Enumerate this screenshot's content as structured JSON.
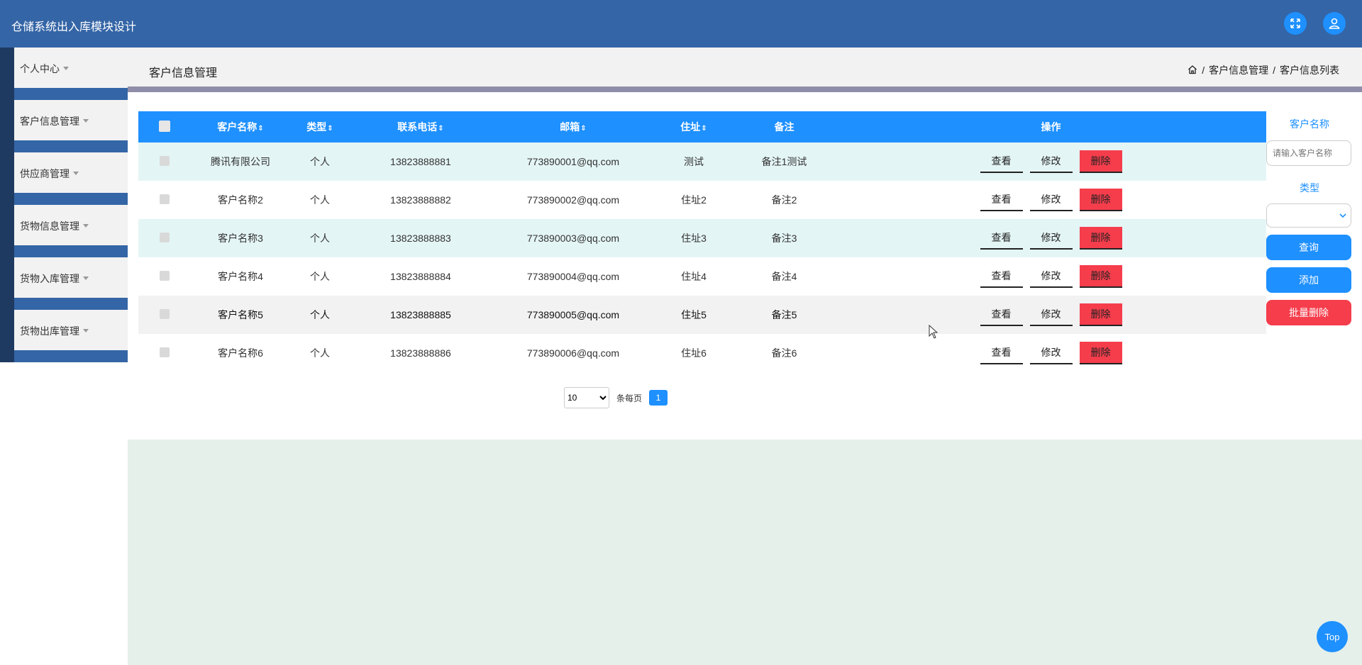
{
  "app": {
    "title": "仓储系统出入库模块设计"
  },
  "header_icons": [
    "fullscreen-icon",
    "user-icon"
  ],
  "sidebar": {
    "items": [
      {
        "label": "个人中心"
      },
      {
        "label": "客户信息管理"
      },
      {
        "label": "供应商管理"
      },
      {
        "label": "货物信息管理"
      },
      {
        "label": "货物入库管理"
      },
      {
        "label": "货物出库管理"
      }
    ]
  },
  "page": {
    "title": "客户信息管理",
    "breadcrumb": {
      "level1": "客户信息管理",
      "level2": "客户信息列表",
      "sep": "/"
    }
  },
  "table": {
    "headers": {
      "name": "客户名称",
      "type": "类型",
      "phone": "联系电话",
      "email": "邮箱",
      "address": "住址",
      "remark": "备注",
      "actions": "操作"
    },
    "sort_glyph": "⇕",
    "rows": [
      {
        "name": "腾讯有限公司",
        "type": "个人",
        "phone": "13823888881",
        "email": "773890001@qq.com",
        "address": "测试",
        "remark": "备注1测试"
      },
      {
        "name": "客户名称2",
        "type": "个人",
        "phone": "13823888882",
        "email": "773890002@qq.com",
        "address": "住址2",
        "remark": "备注2"
      },
      {
        "name": "客户名称3",
        "type": "个人",
        "phone": "13823888883",
        "email": "773890003@qq.com",
        "address": "住址3",
        "remark": "备注3"
      },
      {
        "name": "客户名称4",
        "type": "个人",
        "phone": "13823888884",
        "email": "773890004@qq.com",
        "address": "住址4",
        "remark": "备注4"
      },
      {
        "name": "客户名称5",
        "type": "个人",
        "phone": "13823888885",
        "email": "773890005@qq.com",
        "address": "住址5",
        "remark": "备注5"
      },
      {
        "name": "客户名称6",
        "type": "个人",
        "phone": "13823888886",
        "email": "773890006@qq.com",
        "address": "住址6",
        "remark": "备注6"
      }
    ],
    "actions": {
      "view": "查看",
      "edit": "修改",
      "delete": "删除"
    }
  },
  "pagination": {
    "page_size": "10",
    "per_page_label": "条每页",
    "current_page": "1"
  },
  "search": {
    "name_label": "客户名称",
    "name_placeholder": "请输入客户名称",
    "type_label": "类型",
    "type_value": "",
    "query_label": "查询",
    "add_label": "添加",
    "batch_delete_label": "批量删除"
  },
  "top_button": "Top",
  "colors": {
    "header_bg": "#3465a6",
    "primary": "#1e90ff",
    "danger": "#f53d4c",
    "sidebar_dark": "#1f3a61",
    "row_alt": "#e4f5f5",
    "bottom_area": "#e5f0ea"
  }
}
